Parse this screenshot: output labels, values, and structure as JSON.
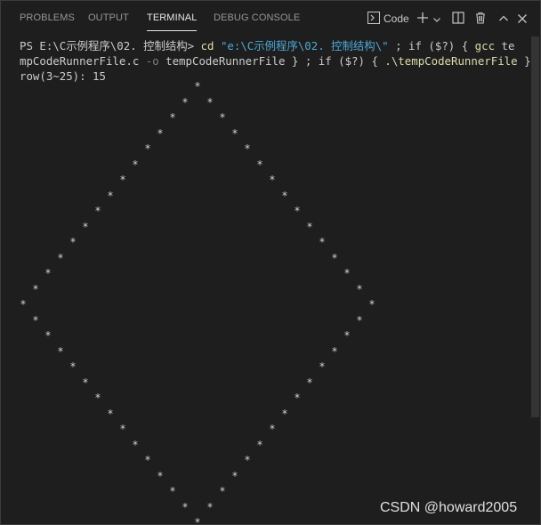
{
  "panel": {
    "tabs": [
      {
        "label": "PROBLEMS",
        "active": false
      },
      {
        "label": "OUTPUT",
        "active": false
      },
      {
        "label": "TERMINAL",
        "active": true
      },
      {
        "label": "DEBUG CONSOLE",
        "active": false
      }
    ],
    "terminal_selector": {
      "icon": "terminal-icon",
      "label": "Code"
    },
    "actions": [
      "add-icon",
      "chevron-down-icon",
      "split-icon",
      "trash-icon",
      "chevron-up-icon",
      "close-icon"
    ]
  },
  "terminal": {
    "prompt": "PS E:\\C示例程序\\02. 控制结构>",
    "cmd_cd": "cd",
    "cd_path": "\"e:\\C示例程序\\02. 控制结构\\\"",
    "sep1": " ; ",
    "kw_if1": "if",
    "cond1": "($?)",
    "brace_open1": "{",
    "cmd_gcc": "gcc",
    "gcc_file_start": "te",
    "line2_file_rest": "mpCodeRunnerFile.c",
    "flag_o": "-o",
    "out_name": "tempCodeRunnerFile",
    "brace_close1": "}",
    "sep2": " ; ",
    "kw_if2": "if",
    "cond2": "($?)",
    "brace_open2": "{",
    "run_exe": ".\\tempCodeRunnerFile",
    "brace_close2": "}",
    "input_prompt": "row(3~25): 15",
    "star_char": "*",
    "diamond_rows": 15
  },
  "watermark": "CSDN @howard2005",
  "colors": {
    "background": "#1e1e1e",
    "command": "#dcdcaa",
    "string": "#4fa8d6",
    "flag": "#7f7f7f",
    "text": "#cccccc"
  }
}
